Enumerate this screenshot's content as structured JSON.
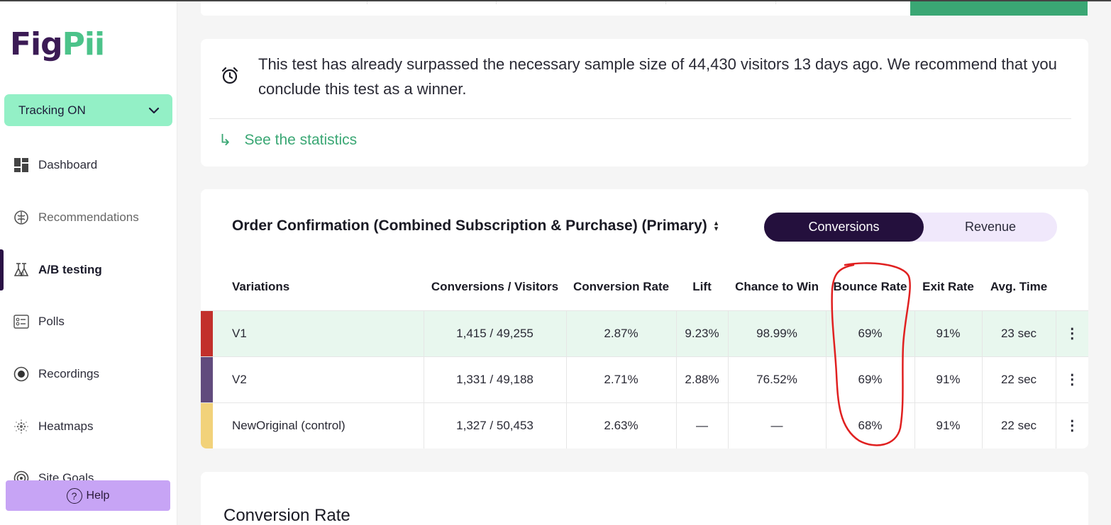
{
  "app": {
    "logo_part1": "Fig",
    "logo_part2": "Pii",
    "brand_primary": "#3b1b55",
    "brand_accent": "#4cc38a"
  },
  "sidebar": {
    "tracking_label": "Tracking ON",
    "items": [
      {
        "label": "Dashboard",
        "icon": "dashboard-icon"
      },
      {
        "label": "Recommendations",
        "icon": "brain-icon"
      },
      {
        "label": "A/B testing",
        "icon": "flask-ab-icon",
        "active": true
      },
      {
        "label": "Polls",
        "icon": "poll-icon"
      },
      {
        "label": "Recordings",
        "icon": "record-icon"
      },
      {
        "label": "Heatmaps",
        "icon": "heatmap-icon"
      },
      {
        "label": "Site Goals",
        "icon": "target-icon"
      }
    ],
    "help_icon": "?",
    "help_label": "Help"
  },
  "alert": {
    "message": "This test has already surpassed the necessary sample size of 44,430 visitors 13 days ago. We recommend that you conclude this test as a winner.",
    "link_arrow": "↳",
    "link_label": "See the statistics"
  },
  "results": {
    "goal_title": "Order Confirmation (Combined Subscription & Purchase) (Primary)",
    "toggle": {
      "active": "Conversions",
      "inactive": "Revenue"
    },
    "columns": [
      "Variations",
      "Conversions / Visitors",
      "Conversion Rate",
      "Lift",
      "Chance to Win",
      "Bounce Rate",
      "Exit Rate",
      "Avg. Time"
    ],
    "rows": [
      {
        "name": "V1",
        "conv_visitors": "1,415 / 49,255",
        "conv_rate": "2.87%",
        "lift": "9.23%",
        "chance": "98.99%",
        "bounce": "69%",
        "exit": "91%",
        "avg_time": "23 sec",
        "color": "#c2302b",
        "menu": "⋮"
      },
      {
        "name": "V2",
        "conv_visitors": "1,331 / 49,188",
        "conv_rate": "2.71%",
        "lift": "2.88%",
        "chance": "76.52%",
        "bounce": "69%",
        "exit": "91%",
        "avg_time": "22 sec",
        "color": "#614b7d",
        "menu": "⋮"
      },
      {
        "name": "NewOriginal (control)",
        "conv_visitors": "1,327 / 50,453",
        "conv_rate": "2.63%",
        "lift": "—",
        "chance": "—",
        "bounce": "68%",
        "exit": "91%",
        "avg_time": "22 sec",
        "color": "#f2d27a",
        "menu": "⋮"
      }
    ]
  },
  "bottom": {
    "title": "Conversion Rate"
  }
}
